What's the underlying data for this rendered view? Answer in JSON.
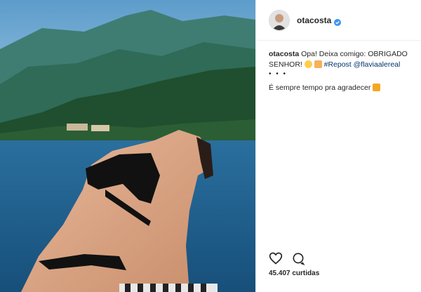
{
  "post": {
    "username": "otacosta",
    "caption": {
      "user": "otacosta",
      "text_part1": "Opa! Deixa comigo: OBRIGADO SENHOR!",
      "hashtag": "#Repost",
      "mention": "@flaviaalereal",
      "dots": "• • •",
      "line2": "É sempre tempo pra agradecer"
    },
    "likes": "45.407 curtidas"
  },
  "colors": {
    "link": "#003569",
    "verified": "#3897f0",
    "sky": "#7fb7d9",
    "sea": "#1f5f8f"
  },
  "icons": [
    "verified-icon",
    "heart-icon",
    "comment-icon"
  ]
}
